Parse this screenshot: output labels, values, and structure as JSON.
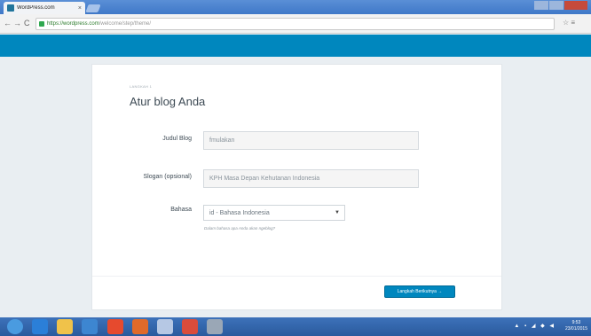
{
  "browser": {
    "tab_title": "WordPress.com",
    "tab_close": "×",
    "url_host": "https://wordpress.com",
    "url_path": "/welcome/step/theme/",
    "nav_back": "←",
    "nav_forward": "→",
    "nav_reload": "C",
    "right_icons": "☆ ≡"
  },
  "setup": {
    "step_label": "LANGKAH 1",
    "heading": "Atur blog Anda",
    "blog_title": {
      "label": "Judul Blog",
      "value": "fmulakan"
    },
    "tagline": {
      "label": "Slogan (opsional)",
      "value": "KPH Masa Depan Kehutanan Indonesia"
    },
    "language": {
      "label": "Bahasa",
      "value": "id - Bahasa Indonesia",
      "hint": "Dalam bahasa apa Anda akan ngeblog?"
    },
    "next_button": "Langkah Berikutnya →"
  },
  "taskbar": {
    "clock_time": "9:53",
    "clock_date": "23/01/2015"
  },
  "colors": {
    "wp_blue": "#0087be",
    "taskbar": "#2f62a8"
  }
}
